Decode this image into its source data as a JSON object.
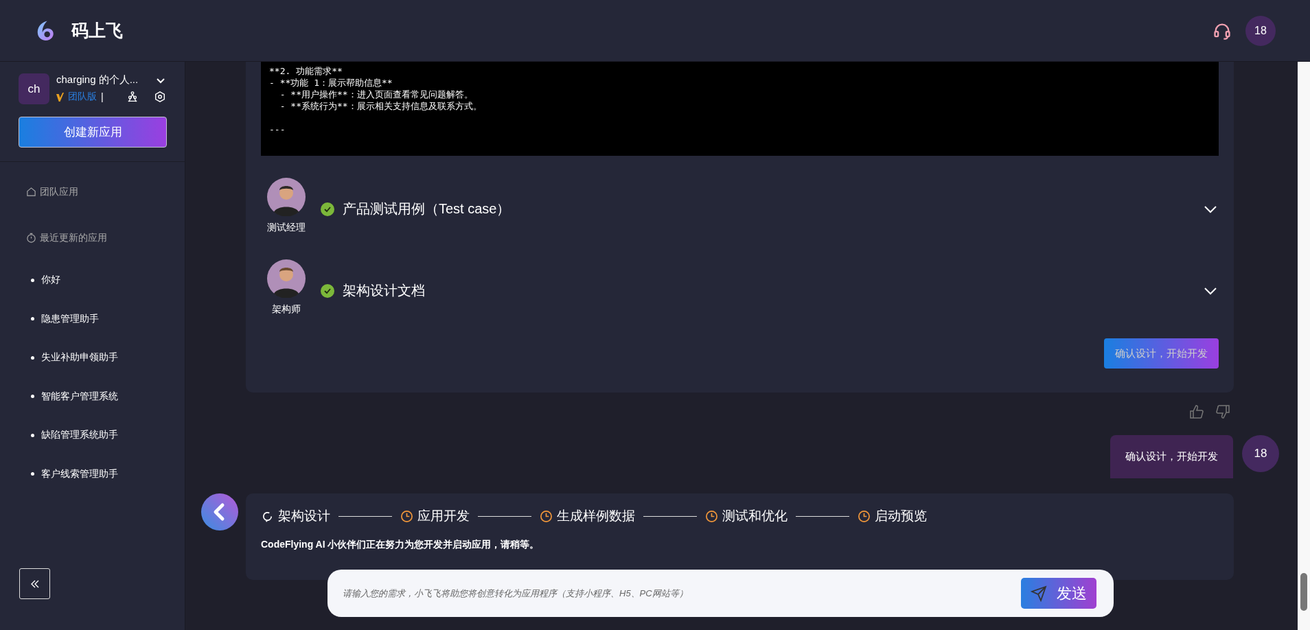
{
  "header": {
    "logo_text": "码上飞",
    "user_avatar": "18"
  },
  "sidebar": {
    "workspace": {
      "avatar": "ch",
      "name": "charging 的个人...",
      "edition": "团队版",
      "separator": "|"
    },
    "create_button": "创建新应用",
    "sections": [
      {
        "kind": "team",
        "label": "团队应用"
      },
      {
        "kind": "recent",
        "label": "最近更新的应用"
      }
    ],
    "apps": [
      "你好",
      "隐患管理助手",
      "失业补助申领助手",
      "智能客户管理系统",
      "缺陷管理系统助手",
      "客户线索管理助手"
    ]
  },
  "chat": {
    "code_paragraphs": [
      [
        "**2. 功能需求**",
        "- **功能 1：展示帮助信息**",
        "  - **用户操作**：进入页面查看常见问题解答。",
        "  - **系统行为**：展示相关支持信息及联系方式。"
      ],
      [
        "---"
      ]
    ],
    "documents": [
      {
        "role": "测试经理",
        "title": "产品测试用例（Test case）",
        "done": true,
        "expanded": false
      },
      {
        "role": "架构师",
        "title": "架构设计文档",
        "done": true,
        "expanded": false
      }
    ],
    "confirm_button": "确认设计，开始开发",
    "user_message": {
      "text": "确认设计，开始开发",
      "avatar": "18"
    },
    "progress": {
      "steps": [
        {
          "label": "架构设计",
          "active": true
        },
        {
          "label": "应用开发",
          "active": false
        },
        {
          "label": "生成样例数据",
          "active": false
        },
        {
          "label": "测试和优化",
          "active": false
        },
        {
          "label": "启动预览",
          "active": false
        }
      ],
      "message": "CodeFlying AI 小伙伴们正在努力为您开发并启动应用，请稍等。"
    }
  },
  "input": {
    "placeholder": "请输入您的需求，小飞飞将助您将创意转化为应用程序（支持小程序、H5、PC网站等）",
    "send_button": "发送"
  }
}
